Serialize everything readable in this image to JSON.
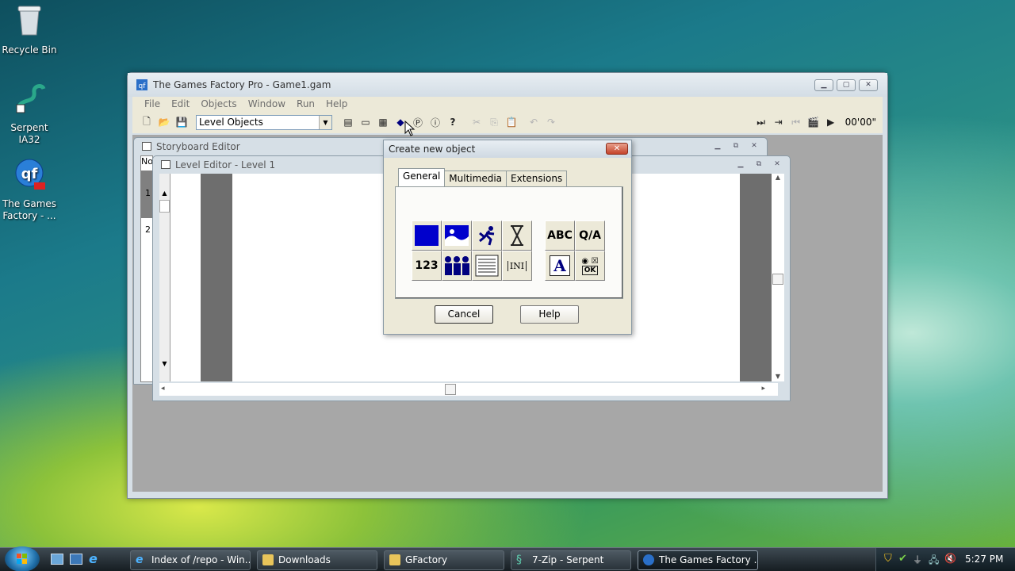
{
  "desktop": {
    "icons": [
      {
        "label": "Recycle Bin"
      },
      {
        "label": "Serpent IA32"
      },
      {
        "label": "The Games Factory - ..."
      }
    ]
  },
  "main_window": {
    "title": "The Games Factory Pro - Game1.gam",
    "window_buttons": {
      "minimize": "▁",
      "maximize": "▢",
      "close": "✕"
    },
    "menu": [
      "File",
      "Edit",
      "Objects",
      "Window",
      "Run",
      "Help"
    ],
    "toolbar": {
      "dropdown_value": "Level Objects",
      "time": "00'00\""
    }
  },
  "storyboard_editor": {
    "title": "Storyboard Editor",
    "col_header": "No",
    "rows": [
      "1",
      "2"
    ]
  },
  "level_editor": {
    "title": "Level Editor - Level 1"
  },
  "dialog": {
    "title": "Create new object",
    "close": "✕",
    "tabs": [
      "General",
      "Multimedia",
      "Extensions"
    ],
    "active_tab": "General",
    "objects": {
      "backdrop": "",
      "picture": "",
      "active": "",
      "timer": "",
      "string": "ABC",
      "question": "Q/A",
      "counter": "123",
      "lives": "",
      "list": "",
      "ini": "INI",
      "formatted_text": "A",
      "edit_box": "OK"
    },
    "buttons": {
      "cancel": "Cancel",
      "help": "Help"
    }
  },
  "taskbar": {
    "items": [
      {
        "label": "Index of /repo - Win...",
        "icon": "ie-icon"
      },
      {
        "label": "Downloads",
        "icon": "folder-icon"
      },
      {
        "label": "GFactory",
        "icon": "folder-icon"
      },
      {
        "label": "7-Zip - Serpent",
        "icon": "serpent-icon"
      },
      {
        "label": "The Games Factory ...",
        "icon": "tgf-icon",
        "active": true
      }
    ],
    "clock": "5:27 PM"
  },
  "colors": {
    "accent_blue": "#0000cc",
    "navy": "#00007f"
  }
}
